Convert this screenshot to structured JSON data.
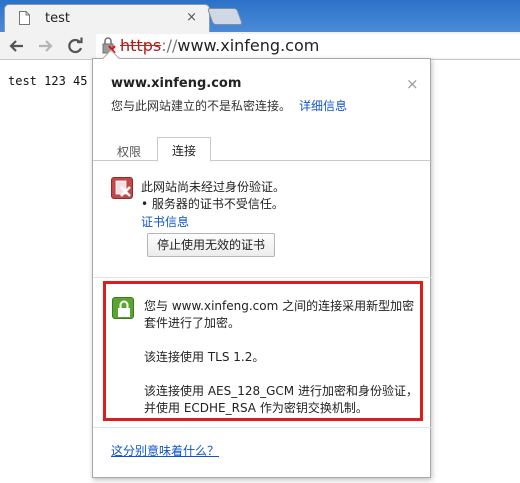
{
  "browser": {
    "tab": {
      "title": "test",
      "close_glyph": "×"
    },
    "url": {
      "scheme": "https",
      "separator": "://",
      "host": "www.xinfeng.com"
    }
  },
  "page": {
    "text": "test 123 45"
  },
  "popup": {
    "close_glyph": "×",
    "site": "www.xinfeng.com",
    "description": "您与此网站建立的不是私密连接。",
    "details_link": "详细信息",
    "tabs": [
      {
        "label": "权限"
      },
      {
        "label": "连接",
        "active": true
      }
    ],
    "identity": {
      "title": "此网站尚未经过身份验证。",
      "bullet": "• 服务器的证书不受信任。",
      "cert_link": "证书信息",
      "stop_button": "停止使用无效的证书"
    },
    "encryption": {
      "line1": "您与 www.xinfeng.com 之间的连接采用新型加密套件进行了加密。",
      "line2": "该连接使用 TLS 1.2。",
      "line3": "该连接使用 AES_128_GCM 进行加密和身份验证，并使用 ECDHE_RSA 作为密钥交换机制。"
    },
    "meaning_link": "这分别意味着什么？"
  },
  "colors": {
    "tabstrip": "#2a72c8",
    "link": "#1155cc",
    "error_icon": "#c24848",
    "ok_icon": "#5aa532",
    "highlight": "#e01b1b"
  },
  "icons": [
    "page-icon",
    "back-arrow-icon",
    "forward-arrow-icon",
    "reload-icon",
    "broken-lock-icon",
    "close-icon",
    "certificate-error-icon",
    "lock-icon"
  ]
}
